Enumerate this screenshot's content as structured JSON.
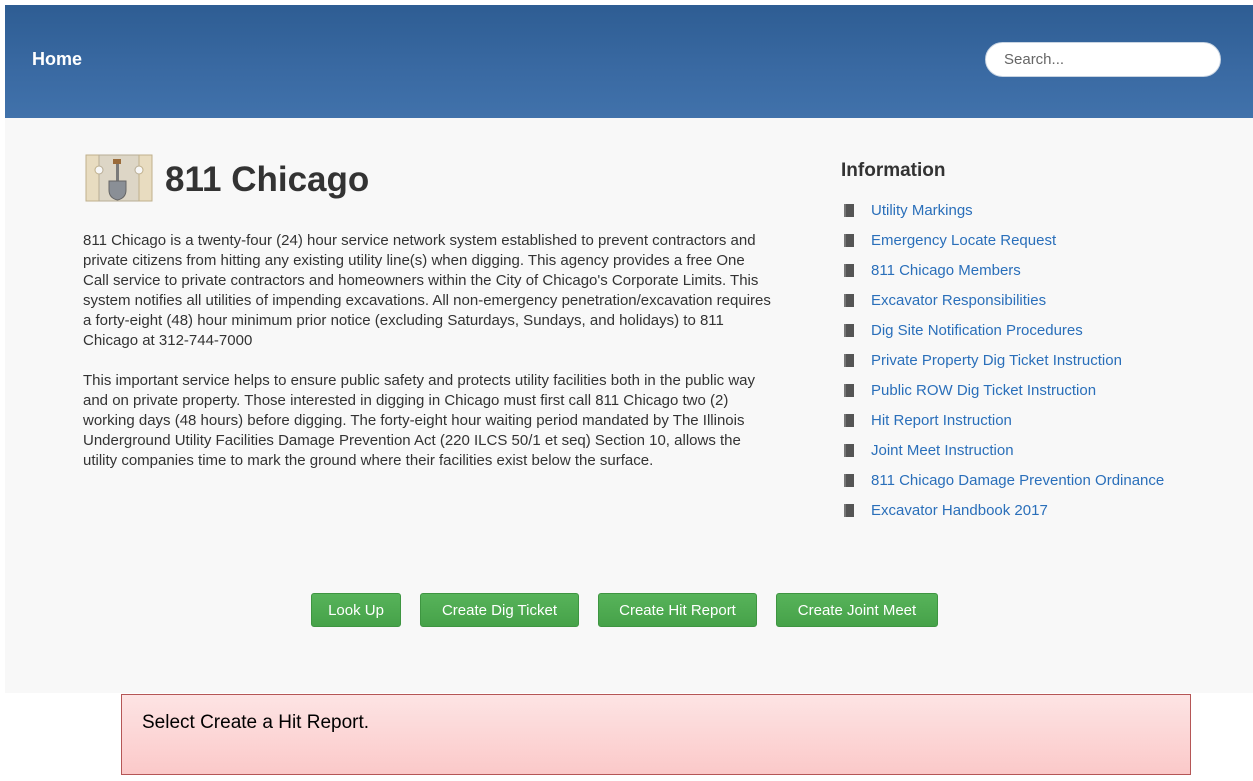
{
  "navbar": {
    "brand": "Home",
    "search_placeholder": "Search..."
  },
  "header": {
    "title": "811 Chicago",
    "logo_icon": "shovel-icon"
  },
  "description": [
    "811 Chicago is a twenty-four (24) hour service network system established to prevent contractors and private citizens from hitting any existing utility line(s) when digging. This agency provides a free One Call service to private contractors and homeowners within the City of Chicago's Corporate Limits. This system notifies all utilities of impending excavations. All non-emergency penetration/excavation requires a forty-eight (48) hour minimum prior notice (excluding Saturdays, Sundays, and holidays) to 811 Chicago at 312-744-7000",
    "This important service helps to ensure public safety and protects utility facilities both in the public way and on private property. Those interested in digging in Chicago must first call 811 Chicago two (2) working days (48 hours) before digging. The forty-eight hour waiting period mandated by The Illinois Underground Utility Facilities Damage Prevention Act (220 ILCS 50/1 et seq) Section 10, allows the utility companies time to mark the ground where their facilities exist below the surface."
  ],
  "information": {
    "title": "Information",
    "links": [
      "Utility Markings",
      "Emergency Locate Request",
      "811 Chicago Members",
      "Excavator Responsibilities",
      "Dig Site Notification Procedures",
      "Private Property Dig Ticket Instruction",
      "Public ROW Dig Ticket Instruction",
      "Hit Report Instruction",
      "Joint Meet Instruction",
      "811 Chicago Damage Prevention Ordinance",
      "Excavator Handbook 2017"
    ]
  },
  "actions": {
    "look_up": "Look Up",
    "create_dig_ticket": "Create Dig Ticket",
    "create_hit_report": "Create Hit Report",
    "create_joint_meet": "Create Joint Meet"
  },
  "callout": {
    "text": "Select Create a Hit Report."
  },
  "colors": {
    "navbar": "#3a6aa3",
    "button_green": "#4cab4f",
    "link_blue": "#2a6fba",
    "callout_bg": "#fbd3d3"
  }
}
